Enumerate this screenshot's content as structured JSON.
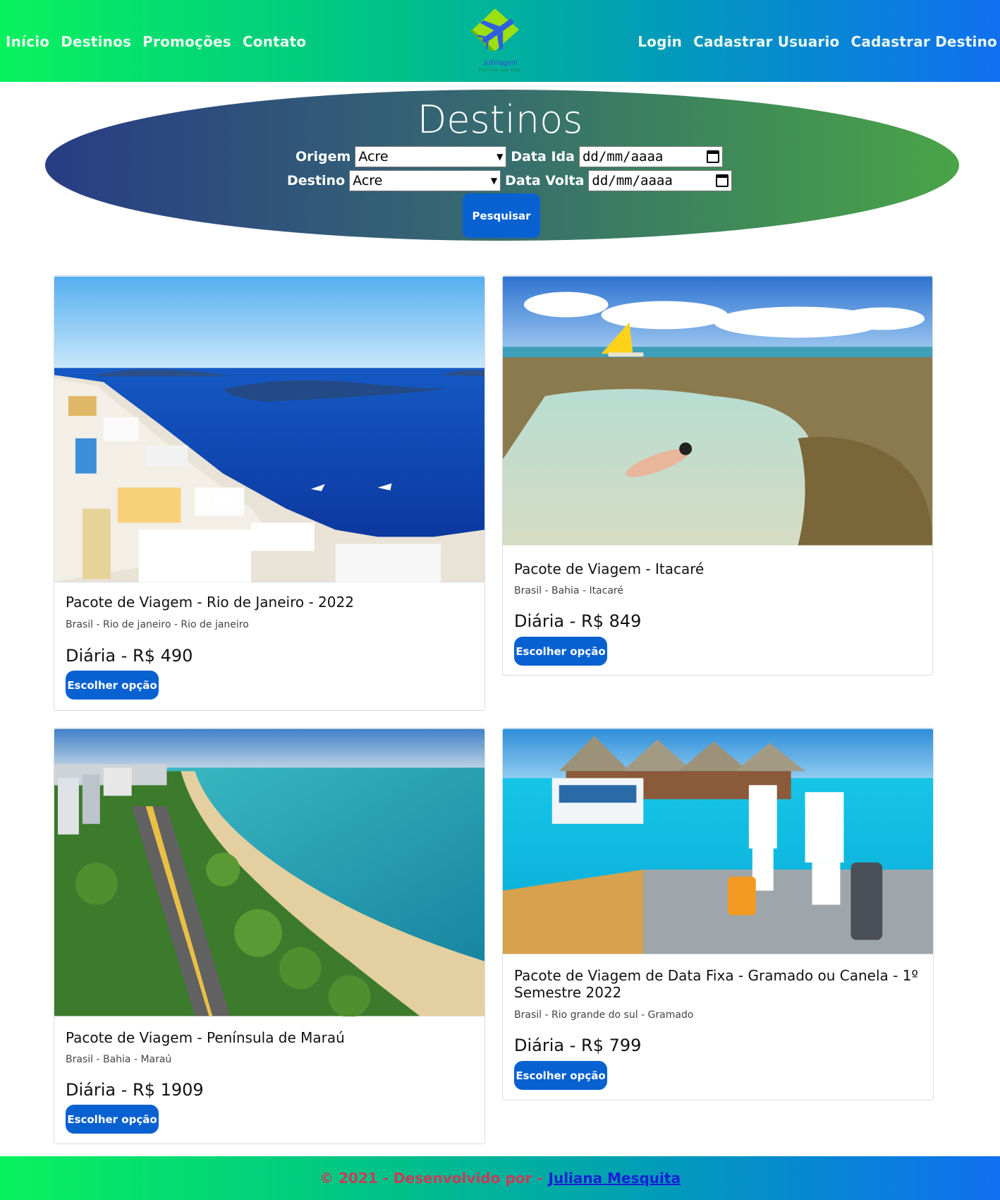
{
  "nav": {
    "left": [
      "Início",
      "Destinos",
      "Promoções",
      "Contato"
    ],
    "right": [
      "Login",
      "Cadastrar Usuario",
      "Cadastrar Destino"
    ]
  },
  "logo": {
    "name": "JuliViagem",
    "tagline": "Facilita sua vida"
  },
  "search": {
    "title": "Destinos",
    "origem_label": "Origem",
    "origem_value": "Acre",
    "data_ida_label": "Data Ida",
    "data_ida_value": "dd/mm/aaaa",
    "destino_label": "Destino",
    "destino_value": "Acre",
    "data_volta_label": "Data Volta",
    "data_volta_value": "dd/mm/aaaa",
    "button": "Pesquisar"
  },
  "cards": [
    {
      "title": "Pacote de Viagem - Rio de Janeiro - 2022",
      "subtitle": "Brasil - Rio de janeiro - Rio de janeiro",
      "price": "Diária - R$ 490",
      "button": "Escolher opção"
    },
    {
      "title": "Pacote de Viagem - Itacaré",
      "subtitle": "Brasil - Bahia - Itacaré",
      "price": "Diária - R$ 849",
      "button": "Escolher opção"
    },
    {
      "title": "Pacote de Viagem - Península de Maraú",
      "subtitle": "Brasil - Bahia - Maraú",
      "price": "Diária - R$ 1909",
      "button": "Escolher opção"
    },
    {
      "title_line1": "Pacote de Viagem de Data Fixa - Gramado ou Canela - 1º",
      "title_line2": "Semestre 2022",
      "subtitle": "Brasil - Rio grande do sul - Gramado",
      "price": "Diária - R$ 799",
      "button": "Escolher opção"
    }
  ],
  "footer": {
    "text": "© 2021 - Desenvolvido por -",
    "link": "Juliana Mesquita"
  },
  "colors": {
    "primary_button": "#0861d1",
    "header_gradient_start": "#08f25e",
    "header_gradient_end": "#1070ef"
  }
}
